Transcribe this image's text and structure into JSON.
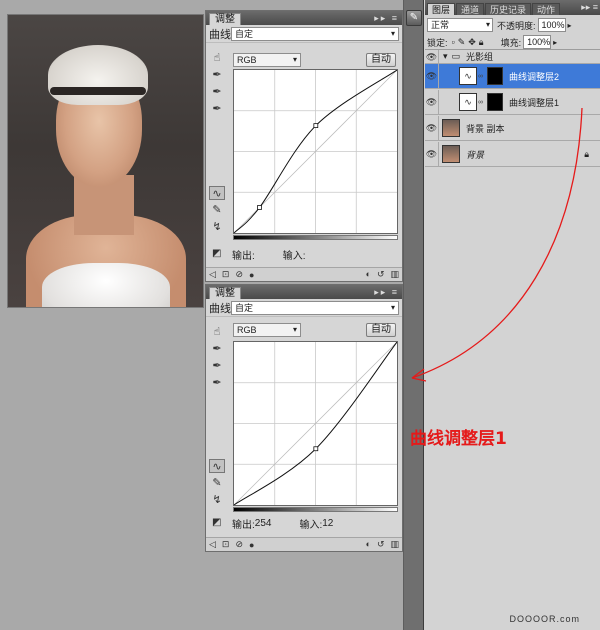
{
  "photo": {
    "alt": ""
  },
  "panel_top": {
    "tab": "调整",
    "label": "曲线",
    "preset": "自定",
    "channel": "RGB",
    "auto_label": "自动",
    "output_label": "输出:",
    "output_value": "",
    "input_label": "输入:",
    "input_value": "",
    "curve": [
      [
        0,
        0
      ],
      [
        40,
        40
      ],
      [
        128,
        168
      ],
      [
        255,
        255
      ]
    ]
  },
  "panel_bottom": {
    "tab": "调整",
    "label": "曲线",
    "preset": "自定",
    "channel": "RGB",
    "auto_label": "自动",
    "output_label": "输出:",
    "output_value": "254",
    "input_label": "输入:",
    "input_value": "12",
    "curve": [
      [
        0,
        0
      ],
      [
        128,
        88
      ],
      [
        255,
        255
      ]
    ]
  },
  "layers": {
    "tabs": [
      "图层",
      "通道",
      "历史记录",
      "动作"
    ],
    "blend_mode": "正常",
    "opacity_label": "不透明度:",
    "opacity": "100%",
    "lock_label": "锁定:",
    "fill_label": "填充:",
    "fill": "100%",
    "items": [
      {
        "name": "光影组",
        "type": "group"
      },
      {
        "name": "曲线调整层2",
        "type": "adjustment",
        "selected": true
      },
      {
        "name": "曲线调整层1",
        "type": "adjustment",
        "selected": false
      },
      {
        "name": "背景 副本",
        "type": "pixel"
      },
      {
        "name": "背景",
        "type": "background"
      }
    ]
  },
  "annotation": "曲线调整层1",
  "watermark": "DOOOOR.com",
  "colors": {
    "annotation": "#e51a1a",
    "selected_layer": "#3e7ad8"
  }
}
